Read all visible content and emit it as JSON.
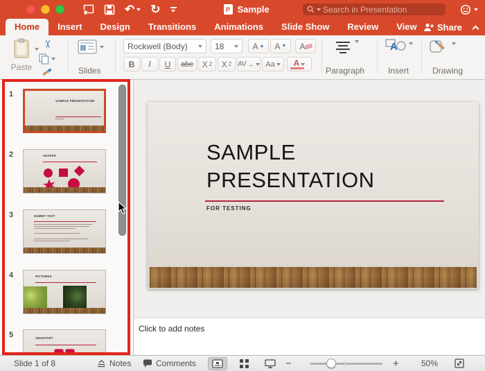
{
  "titlebar": {
    "document_name": "Sample",
    "search_placeholder": "Search in Presentation"
  },
  "tabs": {
    "items": [
      {
        "label": "Home",
        "active": true
      },
      {
        "label": "Insert"
      },
      {
        "label": "Design"
      },
      {
        "label": "Transitions"
      },
      {
        "label": "Animations"
      },
      {
        "label": "Slide Show"
      },
      {
        "label": "Review"
      },
      {
        "label": "View"
      }
    ],
    "share_label": "Share"
  },
  "ribbon": {
    "paste_label": "Paste",
    "slides_label": "Slides",
    "font": {
      "name": "Rockwell (Body)",
      "size": "18",
      "bold": "B",
      "italic": "I",
      "underline": "U",
      "strikethrough": "abe",
      "script_base": "X",
      "superscript_mark": "2",
      "subscript_mark": "2",
      "spacing": "AV",
      "case": "Aa",
      "color": "A",
      "grow": "A",
      "shrink": "A",
      "clear": "A"
    },
    "paragraph_label": "Paragraph",
    "insert_label": "Insert",
    "drawing_label": "Drawing"
  },
  "icons": {
    "undo": "↶",
    "redo": "↻",
    "scissors": "✂",
    "arrow_h": "↔",
    "letter_a": "A",
    "letter_p": "P",
    "grow_arrow": "▲",
    "shrink_arrow": "▼",
    "minus": "−",
    "plus": "+"
  },
  "slide": {
    "title_line1": "SAMPLE",
    "title_line2": "PRESENTATION",
    "subtitle": "FOR TESTING"
  },
  "thumbnails": [
    {
      "number": "1",
      "title": "SAMPLE PRESENTATION",
      "selected": true
    },
    {
      "number": "2",
      "title": "SHAPES"
    },
    {
      "number": "3",
      "title": "DUMMY TEXT"
    },
    {
      "number": "4",
      "title": "PICTURES"
    },
    {
      "number": "5",
      "title": "SMARTART"
    }
  ],
  "notes": {
    "placeholder": "Click to add notes"
  },
  "statusbar": {
    "slide_indicator": "Slide 1 of 8",
    "notes_label": "Notes",
    "comments_label": "Comments",
    "zoom_level": "50%"
  },
  "colors": {
    "titlebar_red": "#D8492B",
    "accent_red": "#B1233E",
    "annotation_red": "#E3241B",
    "selection_orange": "#CE4A23"
  }
}
